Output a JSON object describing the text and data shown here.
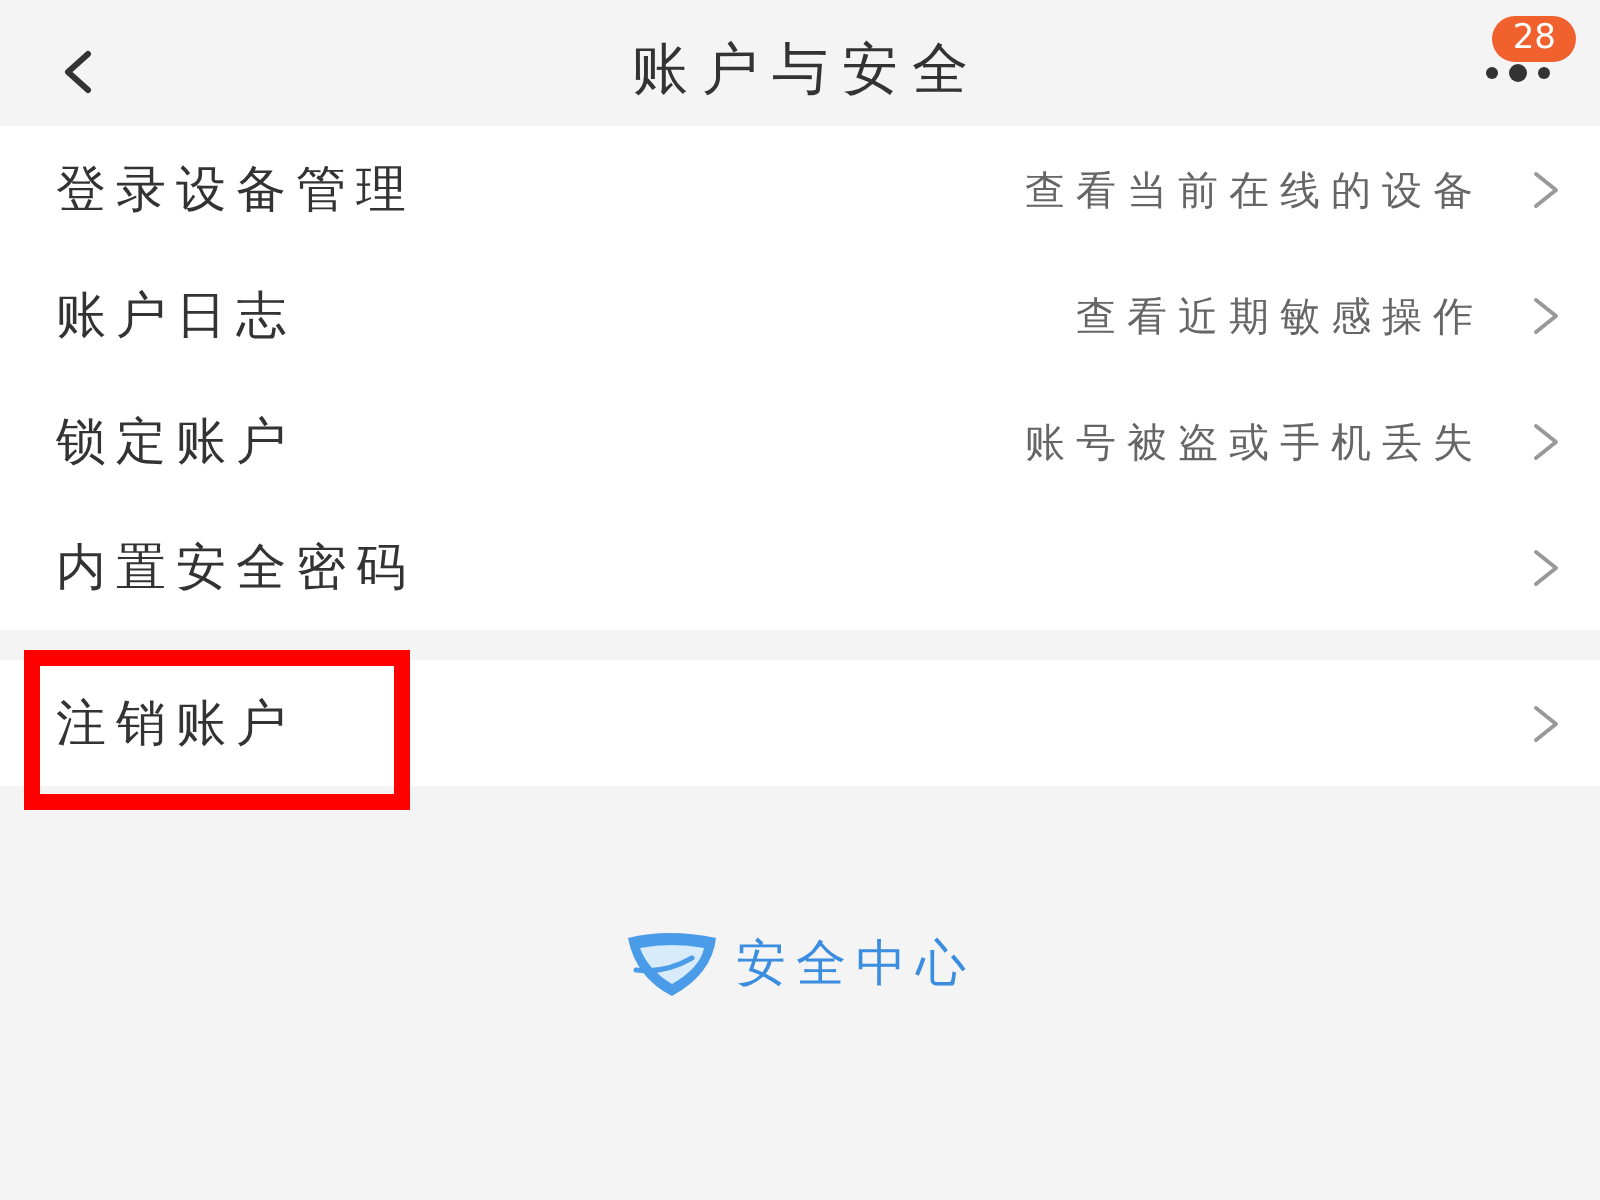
{
  "header": {
    "title": "账户与安全",
    "badge": "28"
  },
  "groups": [
    {
      "items": [
        {
          "label": "登录设备管理",
          "hint": "查看当前在线的设备",
          "highlighted": false
        },
        {
          "label": "账户日志",
          "hint": "查看近期敏感操作",
          "highlighted": false
        },
        {
          "label": "锁定账户",
          "hint": "账号被盗或手机丢失",
          "highlighted": false
        },
        {
          "label": "内置安全密码",
          "highlighted": false
        }
      ]
    },
    {
      "items": [
        {
          "label": "注销账户",
          "highlighted": true
        }
      ]
    }
  ],
  "footer": {
    "text": "安全中心"
  }
}
